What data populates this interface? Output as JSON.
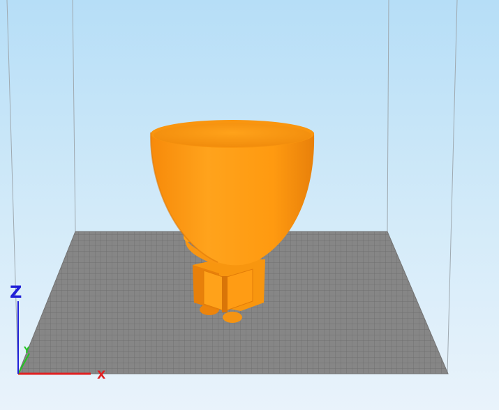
{
  "viewport": {
    "background_top": "#b6def7",
    "background_bottom": "#e9f3fb"
  },
  "build_plate": {
    "color": "#8c8c8c",
    "grid_color": "#6e6e6e",
    "volume_edge_color": "#9a9a9a"
  },
  "model": {
    "color": "#ff9a10",
    "shade_color": "#e8800a"
  },
  "axes": {
    "z_label": "Z",
    "x_label": "X",
    "y_label": "Y",
    "x_color": "#e02020",
    "y_color": "#22c522",
    "z_color": "#2020d8"
  }
}
